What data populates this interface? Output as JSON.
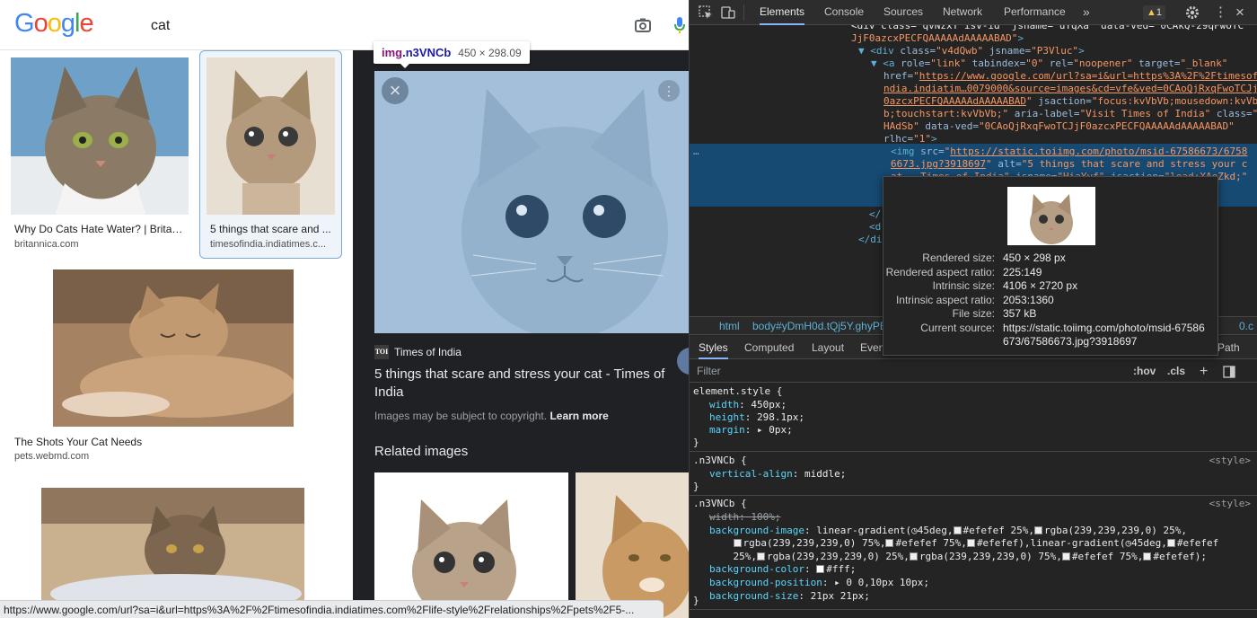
{
  "google": {
    "logo": "Google",
    "query": "cat",
    "results": [
      {
        "title": "Why Do Cats Hate Water? | Britan...",
        "source": "britannica.com"
      },
      {
        "title": "5 things that scare and ...",
        "source": "timesofindia.indiatimes.c..."
      },
      {
        "title": "The Shots Your Cat Needs",
        "source": "pets.webmd.com"
      }
    ],
    "status_url": "https://www.google.com/url?sa=i&url=https%3A%2F%2Ftimesofindia.indiatimes.com%2Flife-style%2Frelationships%2Fpets%2F5-..."
  },
  "tooltip": {
    "tag": "img",
    "class": ".n3VNCb",
    "dims": "450 × 298.09"
  },
  "preview": {
    "close_icon": "×",
    "more_icon": "⋮",
    "source_icon": "TOI",
    "source_name": "Times of India",
    "title": "5 things that scare and stress your cat - Times of India",
    "copyright_text": "Images may be subject to copyright.",
    "learn_more": "Learn more",
    "related_heading": "Related images"
  },
  "devtools": {
    "tabs": [
      "Elements",
      "Console",
      "Sources",
      "Network",
      "Performance"
    ],
    "more_tabs": "»",
    "warning_count": "1",
    "dom_lines": [
      {
        "indent": 180,
        "html": "<span class=\"tx\">&lt;div class=\"qvNzxY isv-id\" jsname=\"uYqXa\" data-ved=\"0CAkQ-29qFwoTC</span>"
      },
      {
        "indent": 180,
        "html": "<span class=\"av\">JjF0azcxPECFQAAAAAdAAAAABAD\"</span><span class=\"tg\">&gt;</span>"
      },
      {
        "indent": 188,
        "html": "<span class=\"tg\">▼ &lt;div </span><span class=\"at\">class=</span><span class=\"av\">\"v4dQwb\"</span><span class=\"at\"> jsname=</span><span class=\"av\">\"P3Vluc\"</span><span class=\"tg\">&gt;</span>"
      },
      {
        "indent": 202,
        "html": "<span class=\"tg\">▼ &lt;a </span><span class=\"at\">role=</span><span class=\"av\">\"link\"</span><span class=\"at\"> tabindex=</span><span class=\"av\">\"0\"</span><span class=\"at\"> rel=</span><span class=\"av\">\"noopener\"</span><span class=\"at\"> target=</span><span class=\"av\">\"_blank\"</span>"
      },
      {
        "indent": 216,
        "html": "<span class=\"at\">href=</span><span class=\"av\">\"</span><span class=\"lk\">https://www.google.com/url?sa=i&amp;url=https%3A%2F%2Ftimesofi</span>"
      },
      {
        "indent": 216,
        "html": "<span class=\"lk\">ndia.indiatim…0079000&amp;source=images&amp;cd=vfe&amp;ved=0CAoQjRxqFwoTCJjF</span>"
      },
      {
        "indent": 216,
        "html": "<span class=\"lk\">0azcxPECFQAAAAAdAAAAABAD</span><span class=\"av\">\"</span><span class=\"at\"> jsaction=</span><span class=\"av\">\"focus:kvVbVb;mousedown:kvVbV</span>"
      },
      {
        "indent": 216,
        "html": "<span class=\"av\">b;touchstart:kvVbVb;\"</span><span class=\"at\"> aria-label=</span><span class=\"av\">\"Visit Times of India\"</span><span class=\"at\"> class=</span><span class=\"av\">\"e</span>"
      },
      {
        "indent": 216,
        "html": "<span class=\"av\">HAdSb\"</span><span class=\"at\"> data-ved=</span><span class=\"av\">\"0CAoQjRxqFwoTCJjF0azcxPECFQAAAAAdAAAAABAD\"</span>"
      },
      {
        "indent": 216,
        "html": "<span class=\"at\">rlhc=</span><span class=\"av\">\"1\"</span><span class=\"tg\">&gt;</span>"
      },
      {
        "indent": 224,
        "html": "<span class=\"tg\">&lt;img </span><span class=\"at\">src=</span><span class=\"av\">\"</span><span class=\"lk\">https://static.toiimg.com/photo/msid-67586673/6758</span>"
      },
      {
        "indent": 224,
        "html": "<span class=\"lk\">6673.jpg?3918697</span><span class=\"av\">\"</span><span class=\"at\"> alt=</span><span class=\"av\">\"5 things that scare and stress your c</span>"
      },
      {
        "indent": 224,
        "html": "<span class=\"av\">at - Times of India\"</span><span class=\"at\"> jsname=</span><span class=\"av\">\"HiaYvf\"</span><span class=\"at\"> jsaction=</span><span class=\"av\">\"load:XAeZkd;\"</span><span class=\"at\">  t: 2</span>"
      },
      {
        "indent": 224,
        "html": "<span class=\"tx\"> </span>"
      },
      {
        "indent": 560,
        "html": "<span class=\"tg\">&gt;</span>"
      },
      {
        "indent": 200,
        "html": "<span class=\"tg\">&lt;/</span>"
      },
      {
        "indent": 200,
        "html": "<span class=\"tg\">&lt;d</span>"
      },
      {
        "indent": 188,
        "html": "<span class=\"tg\">&lt;/di</span>"
      }
    ],
    "ellipsis": "…",
    "breadcrumbs": [
      "html",
      "body#yDmH0d.tQj5Y.ghyPE"
    ],
    "breadcrumb_tail": "0.c",
    "style_tabs": [
      "Styles",
      "Computed",
      "Layout",
      "Even"
    ],
    "style_tab_tail": "Path",
    "filter_placeholder": "Filter",
    "hov": ":hov",
    "cls": ".cls",
    "add_icon": "+",
    "rules": [
      {
        "selector": "element.style {",
        "source": "",
        "props": [
          [
            "width",
            "450px;"
          ],
          [
            "height",
            "298.1px;"
          ],
          [
            "margin",
            "▸ 0px;"
          ]
        ]
      },
      {
        "selector": ".n3VNCb {",
        "source": "<style>",
        "props": [
          [
            "vertical-align",
            "middle;"
          ]
        ]
      },
      {
        "selector": ".n3VNCb {",
        "source": "<style>",
        "props": []
      }
    ],
    "rule3_lines": [
      "<span class=\"pn\" style=\"text-decoration:line-through;color:#9aa0a6\">width: 100%;</span>",
      "<span class=\"pn\">background-image</span>: linear-gradient(◷45deg,<span class=\"sw\" style=\"background:#efefef\"></span>#efefef 25%,<span class=\"sw\" style=\"background:#efefef\"></span>rgba(239,239,239,0) 25%,",
      "    <span class=\"sw\" style=\"background:#efefef\"></span>rgba(239,239,239,0) 75%,<span class=\"sw\" style=\"background:#efefef\"></span>#efefef 75%,<span class=\"sw\" style=\"background:#efefef\"></span>#efefef),linear-gradient(◷45deg,<span class=\"sw\" style=\"background:#efefef\"></span>#efefef",
      "    25%,<span class=\"sw\" style=\"background:#efefef\"></span>rgba(239,239,239,0) 25%,<span class=\"sw\" style=\"background:#efefef\"></span>rgba(239,239,239,0) 75%,<span class=\"sw\" style=\"background:#efefef\"></span>#efefef 75%,<span class=\"sw\" style=\"background:#efefef\"></span>#efefef);",
      "<span class=\"pn\">background-color</span>: <span class=\"sw\" style=\"background:#fff\"></span>#fff;",
      "<span class=\"pn\">background-position</span>: ▸ 0 0,10px 10px;",
      "<span class=\"pn\">background-size</span>: 21px 21px;"
    ],
    "popover": {
      "rows": [
        [
          "Rendered size:",
          "450 × 298 px"
        ],
        [
          "Rendered aspect ratio:",
          "225:149"
        ],
        [
          "Intrinsic size:",
          "4106 × 2720 px"
        ],
        [
          "Intrinsic aspect ratio:",
          "2053:1360"
        ],
        [
          "File size:",
          "357 kB"
        ],
        [
          "Current source:",
          "https://static.toiimg.com/photo/msid-67586"
        ],
        [
          "",
          "673/67586673.jpg?3918697"
        ]
      ]
    }
  }
}
